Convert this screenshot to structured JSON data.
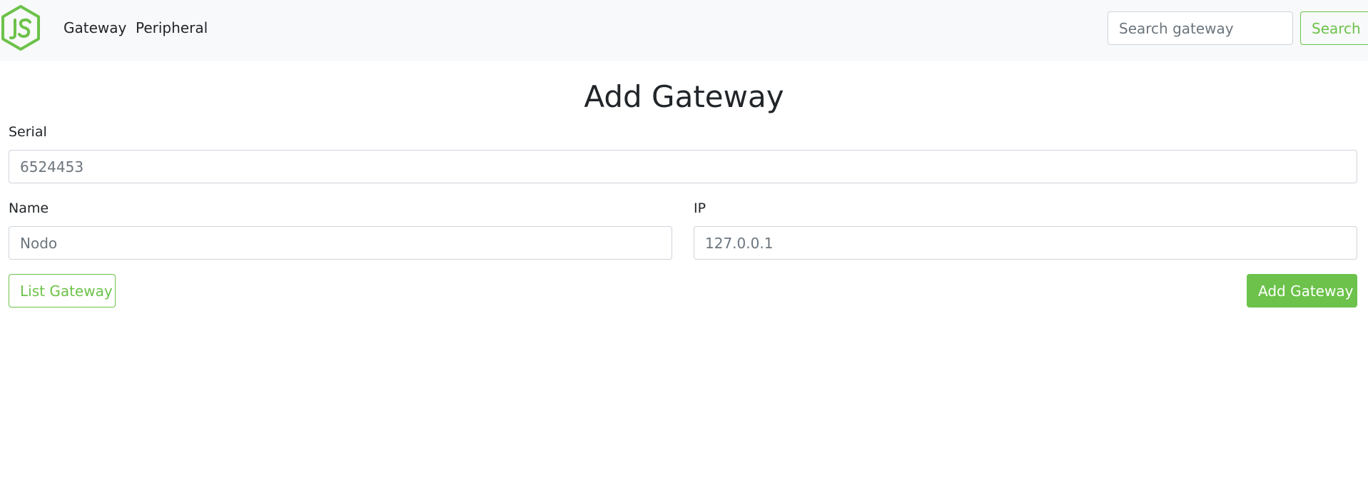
{
  "navbar": {
    "logo_alt": "JS",
    "links": [
      {
        "label": "Gateway"
      },
      {
        "label": "Peripheral"
      }
    ],
    "search": {
      "placeholder": "Search gateway",
      "value": "",
      "button_label": "Search"
    }
  },
  "form": {
    "title": "Add Gateway",
    "serial": {
      "label": "Serial",
      "placeholder": "6524453",
      "value": ""
    },
    "name": {
      "label": "Name",
      "placeholder": "Nodo",
      "value": ""
    },
    "ip": {
      "label": "IP",
      "placeholder": "127.0.0.1",
      "value": ""
    },
    "list_button_label": "List Gateway",
    "submit_button_label": "Add Gateway"
  },
  "colors": {
    "accent": "#6cc24a",
    "navbar_bg": "#f8f9fa",
    "text": "#212529",
    "placeholder": "#6c757d",
    "input_border": "#ced4da"
  },
  "icons": {
    "logo": "nodejs-hexagon-logo"
  }
}
